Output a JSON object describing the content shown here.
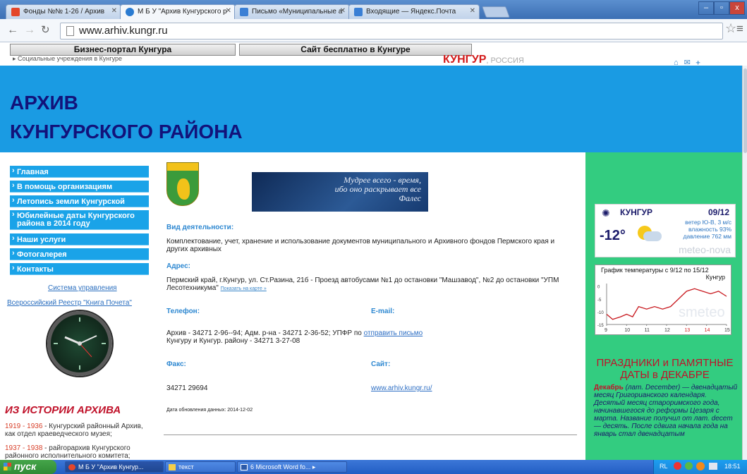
{
  "browser": {
    "tabs": [
      {
        "label": "Фонды №№ 1-26 / Архив",
        "color": "#e4462a"
      },
      {
        "label": "М Б У \"Архив Кунгурского р",
        "color": "#2a7bd1"
      },
      {
        "label": "Письмо «Муниципальные а",
        "color": "#3a7fd5"
      },
      {
        "label": "Входящие — Яндекс.Почта",
        "color": "#3a7fd5"
      }
    ],
    "url": "www.arhiv.kungr.ru",
    "window_controls": [
      "–",
      "▫",
      "x"
    ]
  },
  "topbar": {
    "promo_left": "Бизнес-портал Кунгура",
    "promo_right": "Сайт бесплатно в Кунгуре",
    "crumb": "Социальные учреждения в Кунгуре",
    "brand": "КУНГУР",
    "brand_suffix": ", РОССИЯ"
  },
  "header": {
    "title_line1": "АРХИВ",
    "title_line2": "КУНГУРСКОГО  РАЙОНА"
  },
  "sidebar": {
    "menu": [
      "Главная",
      "В помощь организациям",
      "Летопись земли Кунгурской",
      "Юбилейные даты Кунгурского района в 2014 году",
      "Наши услуги",
      "Фотогалерея",
      "Контакты"
    ],
    "admin_link": "Система управления",
    "registry_link": "Всероссийский Реестр \"Книга Почета\"",
    "history_title": "ИЗ ИСТОРИИ АРХИВА",
    "history": [
      {
        "years": "1919 - 1936",
        "text": " - Кунгурский районный Архив, как отдел краеведческого музея;"
      },
      {
        "years": "1937 - 1938",
        "text": " - райгорархив Кунгурского районного исполнительного комитета;"
      }
    ]
  },
  "main": {
    "banner_line1": "Мудрее всего - время,",
    "banner_line2": "ибо оно раскрывает все",
    "banner_line3": "Фалес",
    "activity_label": "Вид деятельности:",
    "activity_text": "Комплектование, учет, хранение и использование документов муниципального и Архивного фондов Пермского края и других архивных",
    "address_label": "Адрес:",
    "address_text": "Пермский край, г.Кунгур, ул. Ст.Разина, 21б - Проезд автобусами №1 до остановки \"Машзавод\", №2 до остановки \"УПМ Лесотехникума\"",
    "map_link": "Показать на карте »",
    "phone_label": "Телефон:",
    "email_label": "E-mail:",
    "phone_text": "Архив - 34271 2-96--94; Адм. р-на - 34271 2-36-52; УПФР по",
    "phone_text2": "Кунгуру и Кунгур. району - 34271 3-27-08",
    "send_link": "отправить письмо",
    "fax_label": "Факс:",
    "site_label": "Сайт:",
    "fax_value": "34271 29694",
    "site_value": "www.arhiv.kungr.ru/",
    "updated": "Дата обновления данных: 2014-12-02"
  },
  "weather": {
    "city": "КУНГУР",
    "date": "09/12",
    "temp": "-12°",
    "wind": "ветер Ю-В, 3 м/с",
    "humidity": "влажность 93%",
    "pressure": "давление 762 мм",
    "brand": "meteo-nova"
  },
  "graph": {
    "title": "График температуры с 9/12 по 15/12",
    "city": "Кунгур",
    "watermark": "smeteo",
    "x_ticks": [
      "9",
      "10",
      "11",
      "12",
      "13",
      "14",
      "15"
    ],
    "weekend": [
      "13",
      "14"
    ],
    "y_ticks": [
      "0",
      "-5",
      "-10",
      "-15"
    ],
    "ylim": [
      -15,
      1
    ],
    "points": [
      [
        9,
        -11
      ],
      [
        9.3,
        -13
      ],
      [
        9.7,
        -12
      ],
      [
        10,
        -11
      ],
      [
        10.3,
        -12
      ],
      [
        10.6,
        -8
      ],
      [
        11,
        -9
      ],
      [
        11.4,
        -8
      ],
      [
        11.8,
        -9
      ],
      [
        12.2,
        -8
      ],
      [
        12.6,
        -5
      ],
      [
        13,
        -2
      ],
      [
        13.4,
        -1
      ],
      [
        13.8,
        -2
      ],
      [
        14.2,
        -3
      ],
      [
        14.6,
        -2
      ],
      [
        15,
        -4
      ]
    ],
    "line_color": "#c8181e"
  },
  "holidays": {
    "title": "ПРАЗДНИКИ и ПАМЯТНЫЕ ДАТЫ в ДЕКАБРЕ",
    "lead": "Декабрь",
    "text": " (лат. December) — двенадцатый месяц Григорианского календаря. Десятый месяц староримского года, начинавшегося до реформы Цезаря с марта. Название получил от лат. decem — десять. После сдвига начала года на январь стал двенадцатым"
  },
  "taskbar": {
    "start": "пуск",
    "tasks": [
      "М Б У \"Архив Кунгур...",
      "текст",
      "6 Microsoft Word fo..."
    ],
    "lang": "RL",
    "time": "18:51"
  }
}
